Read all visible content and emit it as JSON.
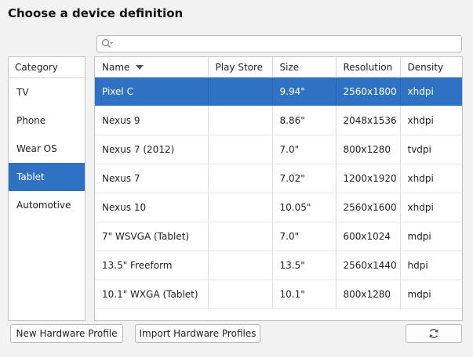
{
  "title": "Choose a device definition",
  "search": {
    "value": "",
    "placeholder": ""
  },
  "categories": {
    "header": "Category",
    "items": [
      "TV",
      "Phone",
      "Wear OS",
      "Tablet",
      "Automotive"
    ],
    "selected": "Tablet"
  },
  "table": {
    "columns": [
      "Name",
      "Play Store",
      "Size",
      "Resolution",
      "Density"
    ],
    "sorted_column": "Name",
    "rows": [
      {
        "name": "Pixel C",
        "play_store": "",
        "size": "9.94\"",
        "resolution": "2560x1800",
        "density": "xhdpi"
      },
      {
        "name": "Nexus 9",
        "play_store": "",
        "size": "8.86\"",
        "resolution": "2048x1536",
        "density": "xhdpi"
      },
      {
        "name": "Nexus 7 (2012)",
        "play_store": "",
        "size": "7.0\"",
        "resolution": "800x1280",
        "density": "tvdpi"
      },
      {
        "name": "Nexus 7",
        "play_store": "",
        "size": "7.02\"",
        "resolution": "1200x1920",
        "density": "xhdpi"
      },
      {
        "name": "Nexus 10",
        "play_store": "",
        "size": "10.05\"",
        "resolution": "2560x1600",
        "density": "xhdpi"
      },
      {
        "name": "7\" WSVGA (Tablet)",
        "play_store": "",
        "size": "7.0\"",
        "resolution": "600x1024",
        "density": "mdpi"
      },
      {
        "name": "13.5\" Freeform",
        "play_store": "",
        "size": "13.5\"",
        "resolution": "2560x1440",
        "density": "hdpi"
      },
      {
        "name": "10.1\" WXGA (Tablet)",
        "play_store": "",
        "size": "10.1\"",
        "resolution": "800x1280",
        "density": "mdpi"
      }
    ],
    "selected_row": "Pixel C"
  },
  "buttons": {
    "new_profile": "New Hardware Profile",
    "import_profiles": "Import Hardware Profiles",
    "refresh_icon": "refresh-icon"
  },
  "colors": {
    "selection": "#2f72c3"
  }
}
